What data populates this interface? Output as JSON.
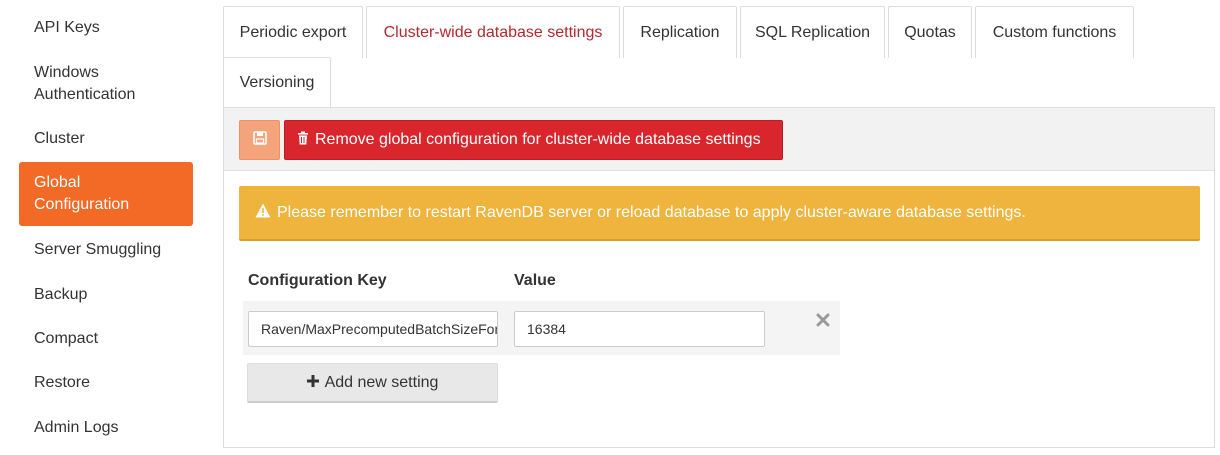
{
  "sidebar": {
    "items": [
      {
        "label": "API Keys"
      },
      {
        "label": "Windows Authentication"
      },
      {
        "label": "Cluster"
      },
      {
        "label": "Global Configuration",
        "active": true
      },
      {
        "label": "Server Smuggling"
      },
      {
        "label": "Backup"
      },
      {
        "label": "Compact"
      },
      {
        "label": "Restore"
      },
      {
        "label": "Admin Logs"
      }
    ]
  },
  "tabs": [
    {
      "label": "Periodic export"
    },
    {
      "label": "Cluster-wide database settings",
      "active": true
    },
    {
      "label": "Replication"
    },
    {
      "label": "SQL Replication"
    },
    {
      "label": "Quotas"
    },
    {
      "label": "Custom functions"
    },
    {
      "label": "Versioning"
    }
  ],
  "toolbar": {
    "save_icon": "save-icon",
    "remove_label": "Remove global configuration for cluster-wide database settings",
    "remove_icon": "trash-icon"
  },
  "warning": {
    "icon": "warning-icon",
    "text": "Please remember to restart RavenDB server or reload database to apply cluster-aware database settings."
  },
  "table": {
    "headers": {
      "key": "Configuration Key",
      "value": "Value"
    },
    "rows": [
      {
        "key": "Raven/MaxPrecomputedBatchSizeForNewIndex",
        "value": "16384"
      }
    ]
  },
  "add_button": {
    "label": "Add new setting",
    "icon": "plus-icon"
  },
  "colors": {
    "accent": "#f26a25",
    "danger": "#d9262c",
    "warning": "#eeb43d",
    "active_tab_text": "#b5282e"
  }
}
